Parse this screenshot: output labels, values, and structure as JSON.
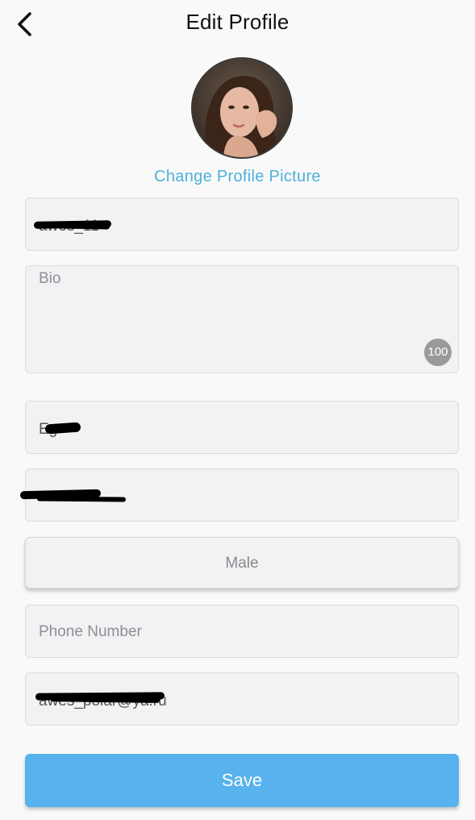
{
  "header": {
    "title": "Edit Profile",
    "back_icon": "chevron-left-icon"
  },
  "profile": {
    "avatar": "profile-photo",
    "change_picture_label": "Change Profile Picture"
  },
  "form": {
    "username": {
      "value": "awes_11",
      "redacted": true
    },
    "bio": {
      "placeholder": "Bio",
      "value": "",
      "remaining_chars": "100"
    },
    "first_name": {
      "value": "Eg",
      "redacted": true
    },
    "last_name": {
      "value": "",
      "redacted": true
    },
    "gender": {
      "selected": "Male"
    },
    "phone": {
      "placeholder": "Phone Number",
      "value": ""
    },
    "email": {
      "value": "awes_polar@ya.ru",
      "redacted": true
    }
  },
  "actions": {
    "save_label": "Save"
  },
  "colors": {
    "accent_link": "#4fb0d8",
    "save_button": "#57b2ee",
    "field_bg": "#f2f2f4",
    "page_bg": "#f9f9f9"
  }
}
